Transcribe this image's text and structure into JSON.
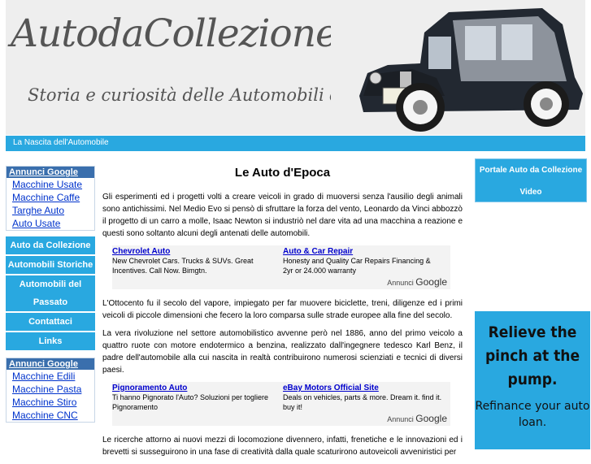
{
  "header": {
    "title": "AutodaCollezione.it",
    "tagline": "Storia e curiosità delle Automobili d'epoca"
  },
  "navbar": {
    "link": "La Nascita dell'Automobile"
  },
  "left_ads_1": {
    "heading": "Annunci Google",
    "items": [
      "Macchine Usate",
      "Macchine Caffe",
      "Targhe Auto",
      "Auto Usate"
    ]
  },
  "left_nav": {
    "items": [
      "Auto da Collezione",
      "Automobili Storiche",
      "Automobili del Passato",
      "Contattaci",
      "Links"
    ]
  },
  "left_ads_2": {
    "heading": "Annunci Google",
    "items": [
      "Macchine Edili",
      "Macchine Pasta",
      "Macchine Stiro",
      "Macchine CNC"
    ]
  },
  "main": {
    "title": "Le Auto d'Epoca",
    "p1": "Gli esperimenti ed i progetti volti a creare veicoli in grado di muoversi senza l'ausilio degli animali sono antichissimi. Nel Medio Evo si pensò di sfruttare la forza del vento, Leonardo da Vinci abbozzò il progetto di un carro a molle, Isaac Newton si industriò nel dare vita ad una macchina a reazione e questi sono soltanto alcuni degli antenati delle automobili.",
    "p2": "L'Ottocento fu il secolo del vapore, impiegato per far muovere biciclette, treni, diligenze ed i primi veicoli di piccole dimensioni che fecero la loro comparsa sulle strade europee alla fine del secolo.",
    "p3": "La vera rivoluzione nel settore automobilistico avvenne però nel 1886, anno del primo veicolo a quattro ruote con motore endotermico a benzina, realizzato dall'ingegnere tedesco Karl Benz, il padre dell'automobile alla cui nascita in realtà contribuirono numerosi scienziati e tecnici di diversi paesi.",
    "p4": "Le ricerche attorno ai nuovi mezzi di locomozione divennero, infatti, frenetiche e le innovazioni ed i brevetti si susseguirono in una fase di creatività dalla quale scaturirono autoveicoli avveniristici per"
  },
  "adblock1": {
    "ad1_title": "Chevrolet Auto",
    "ad1_desc": "New Chevrolet Cars. Trucks & SUVs. Great Incentives. Call Now. Bimgtn.",
    "ad2_title": "Auto & Car Repair",
    "ad2_desc": "Honesty and Quality Car Repairs Financing & 2yr or 24.000 warranty",
    "choices_prefix": "Annunci",
    "choices_brand": "Google"
  },
  "adblock2": {
    "ad1_title": "Pignoramento Auto",
    "ad1_desc": "Ti hanno Pignorato l'Auto? Soluzioni per togliere Pignoramento",
    "ad2_title": "eBay Motors Official Site",
    "ad2_desc": "Deals on vehicles, parts & more. Dream it. find it. buy it!",
    "choices_prefix": "Annunci",
    "choices_brand": "Google"
  },
  "right": {
    "portal_line1": "Portale Auto da Collezione",
    "portal_line2": "Video",
    "banner_big": "Relieve the pinch at the pump.",
    "banner_small": "Refinance your auto loan."
  },
  "colors": {
    "accent": "#29a8e0",
    "ads_heading": "#3a6fad",
    "link": "#0000cc"
  }
}
